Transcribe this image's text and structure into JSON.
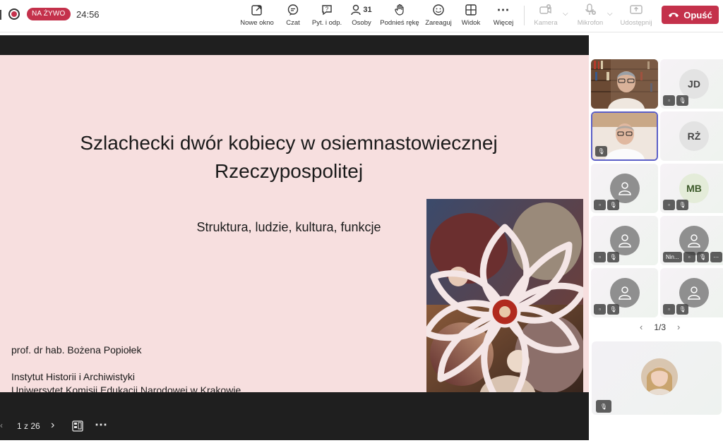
{
  "header": {
    "live_label": "NA ŻYWO",
    "timer": "24:56",
    "toolbar": [
      {
        "label": "Nowe okno",
        "icon": "pop-out-icon"
      },
      {
        "label": "Czat",
        "icon": "chat-icon"
      },
      {
        "label": "Pyt. i odp.",
        "icon": "qa-icon"
      },
      {
        "label": "Osoby",
        "icon": "people-icon",
        "count": "31"
      },
      {
        "label": "Podnieś rękę",
        "icon": "raise-hand-icon"
      },
      {
        "label": "Zareaguj",
        "icon": "react-icon"
      },
      {
        "label": "Widok",
        "icon": "view-grid-icon"
      },
      {
        "label": "Więcej",
        "icon": "more-icon"
      },
      {
        "label": "Kamera",
        "icon": "camera-off-icon",
        "disabled": true
      },
      {
        "label": "Mikrofon",
        "icon": "mic-off-icon",
        "disabled": true
      },
      {
        "label": "Udostępnij",
        "icon": "share-icon",
        "disabled": true
      }
    ],
    "leave_label": "Opuść"
  },
  "slide": {
    "title_line1": "Szlachecki dwór kobiecy w osiemnastowiecznej",
    "title_line2": "Rzeczypospolitej",
    "subtitle": "Struktura, ludzie, kultura, funkcje",
    "author": "prof. dr hab. Bożena Popiołek",
    "institute": "Instytut Historii i Archiwistyki",
    "university": "Uniwersytet Komisji Edukacji Narodowej w Krakowie"
  },
  "slide_controls": {
    "page": "1 z 26"
  },
  "participants": {
    "tiles": [
      {
        "initials": "",
        "video": true
      },
      {
        "initials": "JD"
      },
      {
        "initials": "",
        "video": true
      },
      {
        "initials": "RŻ"
      },
      {
        "initials": ""
      },
      {
        "initials": "MB"
      },
      {
        "initials": ""
      },
      {
        "initials": "",
        "name": "Nin..."
      },
      {
        "initials": ""
      },
      {
        "initials": ""
      }
    ],
    "pager": "1/3"
  },
  "colors": {
    "accent": "#c4314b",
    "selected_border": "#5b5fc7",
    "slide_bg": "#f7dfdf",
    "stage_bg": "#1f1f1f"
  }
}
